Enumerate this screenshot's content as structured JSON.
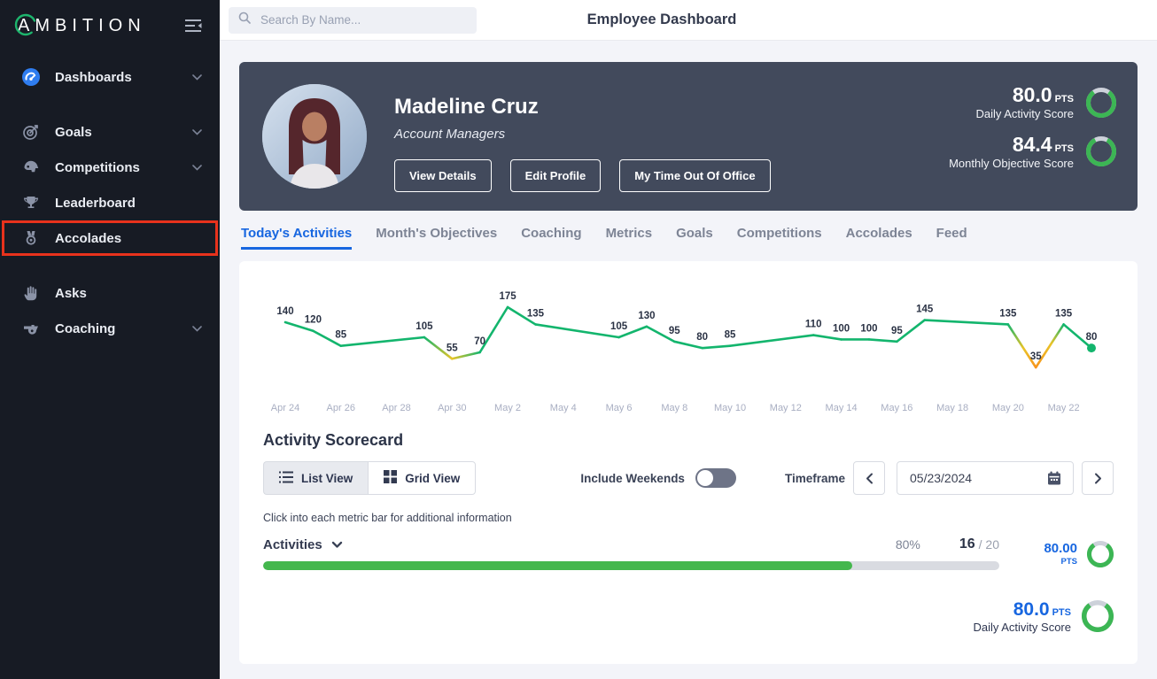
{
  "sidebar": {
    "logo_text": "MBITION",
    "logo_first_letter": "A",
    "items": [
      {
        "label": "Dashboards",
        "icon": "gauge-icon",
        "chevron": true,
        "highlighted": false
      },
      {
        "label": "Goals",
        "icon": "target-icon",
        "chevron": true,
        "highlighted": false
      },
      {
        "label": "Competitions",
        "icon": "helmet-icon",
        "chevron": true,
        "highlighted": false
      },
      {
        "label": "Leaderboard",
        "icon": "trophy-icon",
        "chevron": false,
        "highlighted": false
      },
      {
        "label": "Accolades",
        "icon": "medal-icon",
        "chevron": false,
        "highlighted": true
      },
      {
        "label": "Asks",
        "icon": "hand-icon",
        "chevron": false,
        "highlighted": false
      },
      {
        "label": "Coaching",
        "icon": "whistle-icon",
        "chevron": true,
        "highlighted": false
      }
    ]
  },
  "topbar": {
    "search_placeholder": "Search By Name...",
    "title": "Employee Dashboard"
  },
  "profile": {
    "name": "Madeline Cruz",
    "role": "Account Managers",
    "buttons": [
      {
        "label": "View Details"
      },
      {
        "label": "Edit Profile"
      },
      {
        "label": "My Time Out Of Office"
      }
    ],
    "scores": [
      {
        "value": "80.0",
        "unit": "PTS",
        "label": "Daily Activity Score",
        "percent": 80
      },
      {
        "value": "84.4",
        "unit": "PTS",
        "label": "Monthly Objective Score",
        "percent": 84.4
      }
    ]
  },
  "tabs": [
    {
      "label": "Today's Activities",
      "active": true
    },
    {
      "label": "Month's Objectives",
      "active": false
    },
    {
      "label": "Coaching",
      "active": false
    },
    {
      "label": "Metrics",
      "active": false
    },
    {
      "label": "Goals",
      "active": false
    },
    {
      "label": "Competitions",
      "active": false
    },
    {
      "label": "Accolades",
      "active": false
    },
    {
      "label": "Feed",
      "active": false
    }
  ],
  "chart_data": {
    "type": "line",
    "title": "",
    "xlabel": "",
    "ylabel": "",
    "legend": "none",
    "grid": false,
    "ylim": [
      0,
      200
    ],
    "x": [
      "2024-04-24",
      "2024-04-25",
      "2024-04-26",
      "2024-04-29",
      "2024-04-30",
      "2024-05-01",
      "2024-05-02",
      "2024-05-03",
      "2024-05-06",
      "2024-05-07",
      "2024-05-08",
      "2024-05-09",
      "2024-05-10",
      "2024-05-13",
      "2024-05-14",
      "2024-05-15",
      "2024-05-16",
      "2024-05-17",
      "2024-05-20",
      "2024-05-21",
      "2024-05-22",
      "2024-05-23"
    ],
    "values": [
      140,
      120,
      85,
      105,
      55,
      70,
      175,
      135,
      105,
      130,
      95,
      80,
      85,
      110,
      100,
      100,
      95,
      145,
      135,
      35,
      135,
      80
    ],
    "point_labels": true,
    "tick_labels": [
      "Apr 24",
      "Apr 26",
      "Apr 28",
      "Apr 30",
      "May 2",
      "May 4",
      "May 6",
      "May 8",
      "May 10",
      "May 12",
      "May 14",
      "May 16",
      "May 18",
      "May 20",
      "May 22"
    ],
    "colors": {
      "high": "#13b56d",
      "mid": "#e9c428",
      "low": "#f7941d"
    },
    "thresholds": {
      "mid_below": 70,
      "low_below": 45
    }
  },
  "scorecard": {
    "title": "Activity Scorecard",
    "view_buttons": [
      {
        "label": "List View",
        "selected": true
      },
      {
        "label": "Grid View",
        "selected": false
      }
    ],
    "include_weekends_label": "Include Weekends",
    "include_weekends_on": false,
    "timeframe_label": "Timeframe",
    "date_value": "05/23/2024",
    "note": "Click into each metric bar for additional information",
    "metric": {
      "name": "Activities",
      "percent_text": "80%",
      "completed": "16",
      "total": "/ 20",
      "points": "80.00",
      "points_unit": "PTS",
      "progress_percent": 80
    },
    "summary": {
      "value": "80.0",
      "unit": "PTS",
      "label": "Daily Activity Score",
      "percent": 80
    }
  },
  "colors": {
    "accent_blue": "#1766e0",
    "chart_green": "#13b56d",
    "chart_yellow": "#e9c428",
    "chart_orange": "#f7941d",
    "bar_green": "#44b74d",
    "ring_green": "#3cb654",
    "ring_track": "#cdd1da",
    "sidebar_bg": "#171b24",
    "card_dark": "#424a5c",
    "highlight_red": "#e8321c"
  }
}
